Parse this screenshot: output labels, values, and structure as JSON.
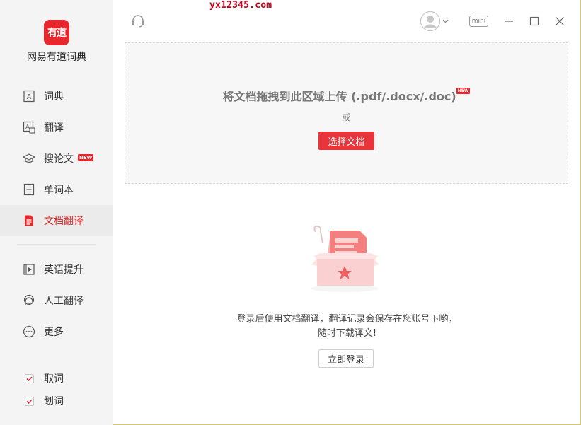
{
  "watermark": "yx12345.com",
  "app": {
    "logo_text": "有道",
    "name": "网易有道词典"
  },
  "sidebar": {
    "items": [
      {
        "label": "词典",
        "icon": "dictionary-icon"
      },
      {
        "label": "翻译",
        "icon": "translate-icon"
      },
      {
        "label": "搜论文",
        "icon": "graduation-cap-icon",
        "badge": "NEW"
      },
      {
        "label": "单词本",
        "icon": "wordbook-icon"
      },
      {
        "label": "文档翻译",
        "icon": "document-icon",
        "active": true
      },
      {
        "label": "英语提升",
        "icon": "video-play-icon"
      },
      {
        "label": "人工翻译",
        "icon": "human-translate-icon"
      },
      {
        "label": "更多",
        "icon": "more-icon"
      }
    ],
    "checks": [
      {
        "label": "取词",
        "checked": true
      },
      {
        "label": "划词",
        "checked": true
      }
    ]
  },
  "topbar": {
    "mini_label": "mini"
  },
  "upload": {
    "title": "将文档拖拽到此区域上传 (.pdf/.docx/.doc)",
    "title_badge": "NEW",
    "or_text": "或",
    "select_button": "选择文档"
  },
  "empty_state": {
    "line1": "登录后使用文档翻译，翻译记录会保存在您账号下哟，",
    "line2": "随时下载译文!",
    "login_button": "立即登录"
  },
  "colors": {
    "accent": "#e8262e",
    "sidebar_bg": "#f4f4f4",
    "active_text": "#e02a2a"
  }
}
